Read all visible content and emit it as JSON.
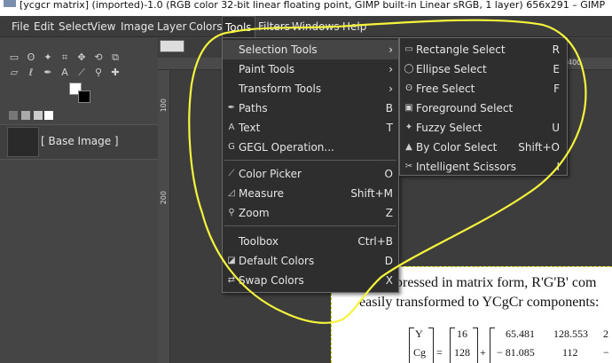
{
  "window": {
    "title": "[ycgcr matrix] (imported)-1.0 (RGB color 32-bit linear floating point, GIMP built-in Linear sRGB, 1 layer) 656x291 – GIMP"
  },
  "menubar": [
    {
      "label": "File"
    },
    {
      "label": "Edit"
    },
    {
      "label": "Select"
    },
    {
      "label": "View"
    },
    {
      "label": "Image"
    },
    {
      "label": "Layer"
    },
    {
      "label": "Colors"
    },
    {
      "label": "Tools"
    },
    {
      "label": "Filters"
    },
    {
      "label": "Windows"
    },
    {
      "label": "Help"
    }
  ],
  "tools_menu": {
    "items": [
      {
        "label": "Selection Tools",
        "accel": "›",
        "icon": ""
      },
      {
        "label": "Paint Tools",
        "accel": "›",
        "icon": ""
      },
      {
        "label": "Transform Tools",
        "accel": "›",
        "icon": ""
      },
      {
        "label": "Paths",
        "accel": "B",
        "icon": "paths-icon"
      },
      {
        "label": "Text",
        "accel": "T",
        "icon": "text-icon"
      },
      {
        "label": "GEGL Operation...",
        "accel": "",
        "icon": "gegl-icon"
      },
      {
        "label": "Color Picker",
        "accel": "O",
        "icon": "color-picker-icon"
      },
      {
        "label": "Measure",
        "accel": "Shift+M",
        "icon": "measure-icon"
      },
      {
        "label": "Zoom",
        "accel": "Z",
        "icon": "zoom-icon"
      },
      {
        "label": "Toolbox",
        "accel": "Ctrl+B",
        "icon": ""
      },
      {
        "label": "Default Colors",
        "accel": "D",
        "icon": "default-colors-icon"
      },
      {
        "label": "Swap Colors",
        "accel": "X",
        "icon": "swap-colors-icon"
      }
    ]
  },
  "selection_submenu": {
    "items": [
      {
        "label": "Rectangle Select",
        "accel": "R",
        "icon": "rectangle-select-icon"
      },
      {
        "label": "Ellipse Select",
        "accel": "E",
        "icon": "ellipse-select-icon"
      },
      {
        "label": "Free Select",
        "accel": "F",
        "icon": "free-select-icon"
      },
      {
        "label": "Foreground Select",
        "accel": "",
        "icon": "foreground-select-icon"
      },
      {
        "label": "Fuzzy Select",
        "accel": "U",
        "icon": "fuzzy-select-icon"
      },
      {
        "label": "By Color Select",
        "accel": "Shift+O",
        "icon": "by-color-select-icon"
      },
      {
        "label": "Intelligent Scissors",
        "accel": "I",
        "icon": "scissors-icon"
      }
    ]
  },
  "layers": {
    "layer_name": "[ Base Image ]"
  },
  "rulers": {
    "top_label": "400",
    "left_labels": [
      "100",
      "200"
    ]
  },
  "document": {
    "line1": "pressed in matrix form, R'G'B' com",
    "line2": "easily transformed to YCgCr components:",
    "matrix_left": [
      "Y",
      "Cg"
    ],
    "matrix_offset": [
      "16",
      "128"
    ],
    "matrix_row1": [
      "65.481",
      "128.553",
      "2"
    ],
    "matrix_row2": [
      "− 81.085",
      "112",
      "−"
    ],
    "equals": "=",
    "plus": "+"
  },
  "colors": {
    "menu_bg": "#2e2e2e",
    "highlight": "#454545",
    "annotation": "#f4f43c"
  }
}
